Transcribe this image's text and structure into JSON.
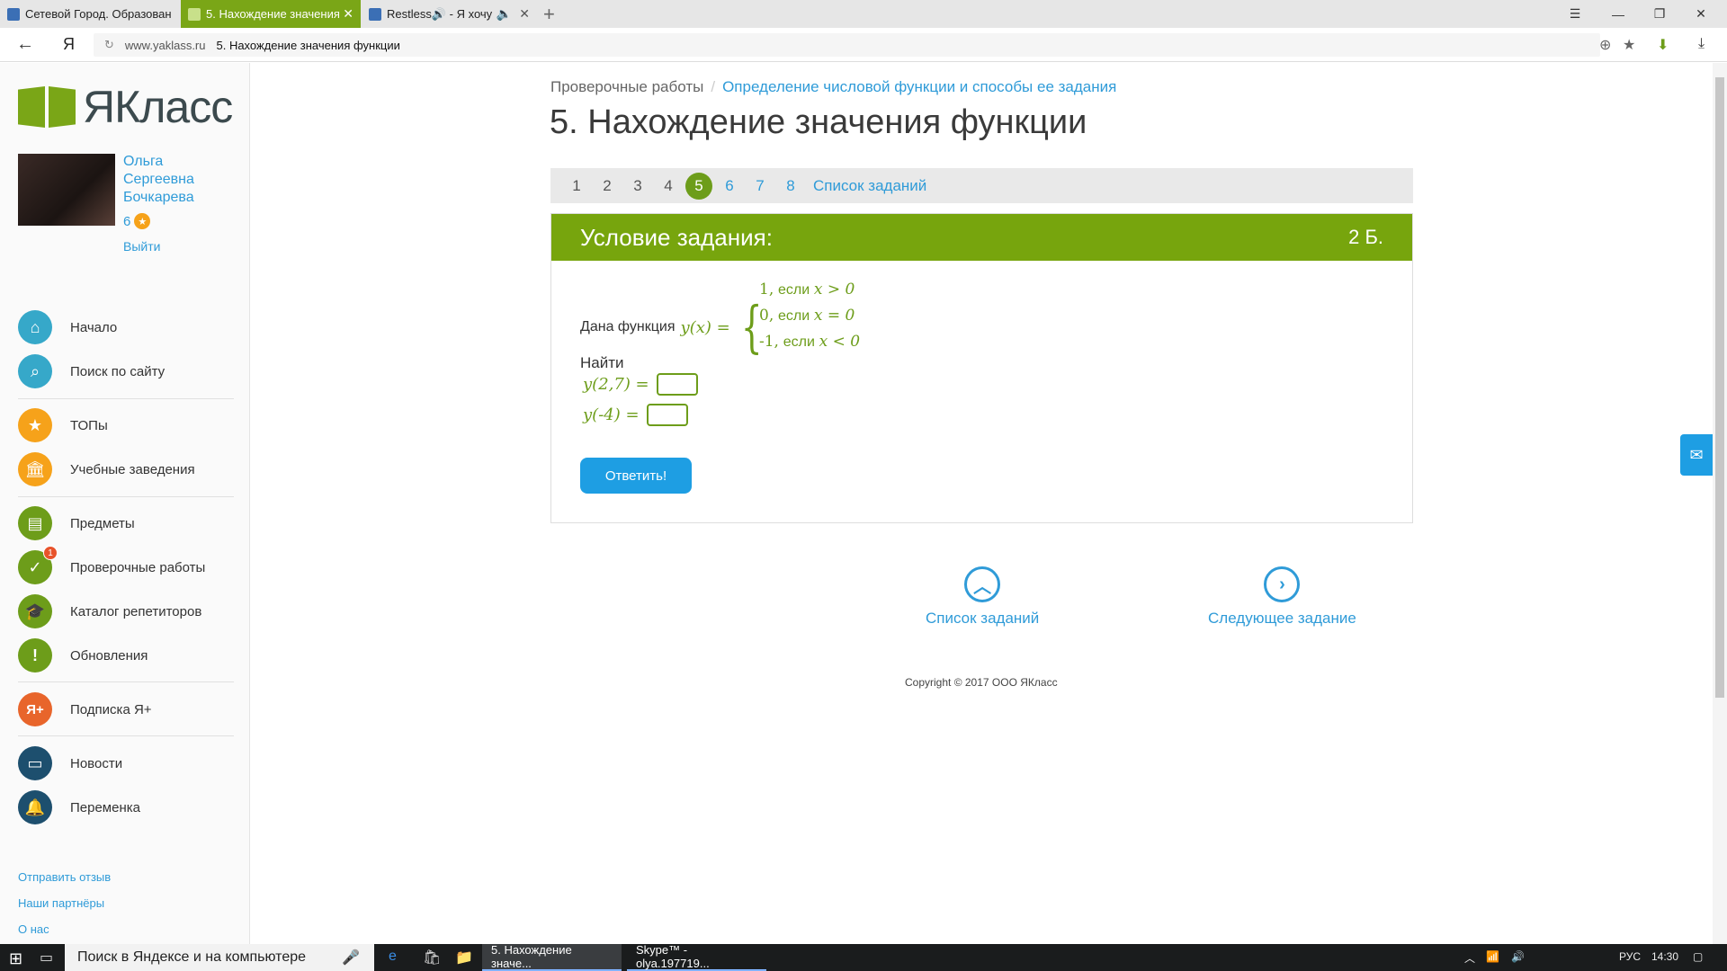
{
  "browser": {
    "tabs": [
      {
        "title": "Сетевой Город. Образован"
      },
      {
        "title": "5. Нахождение значения"
      },
      {
        "title": "Restless🔊 - Я хочу"
      }
    ],
    "url_host": "www.yaklass.ru",
    "url_title": "5. Нахождение значения функции"
  },
  "sidebar": {
    "logo_text": "ЯКласс",
    "user_name": "Ольга Сергеевна Бочкарева",
    "user_points": "6",
    "logout": "Выйти",
    "menu": [
      {
        "label": "Начало",
        "color": "#36a8c9",
        "icon": "home-icon"
      },
      {
        "label": "Поиск по сайту",
        "color": "#36a8c9",
        "icon": "search-icon"
      },
      {
        "label": "ТОПы",
        "color": "#f6a21a",
        "icon": "star-icon"
      },
      {
        "label": "Учебные заведения",
        "color": "#f6a21a",
        "icon": "building-icon"
      },
      {
        "label": "Предметы",
        "color": "#6d9d1a",
        "icon": "book-icon"
      },
      {
        "label": "Проверочные работы",
        "color": "#6d9d1a",
        "icon": "check-icon",
        "badge": "1"
      },
      {
        "label": "Каталог репетиторов",
        "color": "#6d9d1a",
        "icon": "graduation-cap-icon"
      },
      {
        "label": "Обновления",
        "color": "#6d9d1a",
        "icon": "exclamation-icon"
      },
      {
        "label": "Подписка Я+",
        "color": "#e8652b",
        "icon": "ya-plus-icon"
      },
      {
        "label": "Новости",
        "color": "#1d4f6e",
        "icon": "chat-icon"
      },
      {
        "label": "Переменка",
        "color": "#1d4f6e",
        "icon": "bell-icon"
      }
    ],
    "footer_links": [
      "Отправить отзыв",
      "Наши партнёры",
      "О нас"
    ]
  },
  "main": {
    "breadcrumb": {
      "root": "Проверочные работы",
      "separator": "/",
      "current": "Определение числовой функции и способы ее задания"
    },
    "title": "5. Нахождение значения функции",
    "pager": {
      "pages": [
        "1",
        "2",
        "3",
        "4",
        "5",
        "6",
        "7",
        "8"
      ],
      "current": "5",
      "list_label": "Список заданий"
    },
    "task": {
      "header": "Условие задания:",
      "points": "2 Б.",
      "given_label": "Дана функция",
      "function_lhs": "y(x) =",
      "cases": [
        {
          "value": "1,",
          "word": "если",
          "cond": "x > 0"
        },
        {
          "value": "0,",
          "word": "если",
          "cond": "x = 0"
        },
        {
          "value": "-1,",
          "word": "если",
          "cond": "x < 0"
        }
      ],
      "find_label": "Найти",
      "questions": [
        "y(2,7) =",
        "y(-4) ="
      ],
      "answer_button": "Ответить!"
    },
    "nav": {
      "list": "Список заданий",
      "next": "Следующее задание"
    },
    "copyright": "Copyright © 2017 ООО ЯКласс"
  },
  "taskbar": {
    "search_placeholder": "Поиск в Яндексе и на компьютере",
    "apps": [
      "5. Нахождение значе...",
      "Skype™ - olya.197719..."
    ],
    "language": "РУС",
    "time": "14:30"
  }
}
